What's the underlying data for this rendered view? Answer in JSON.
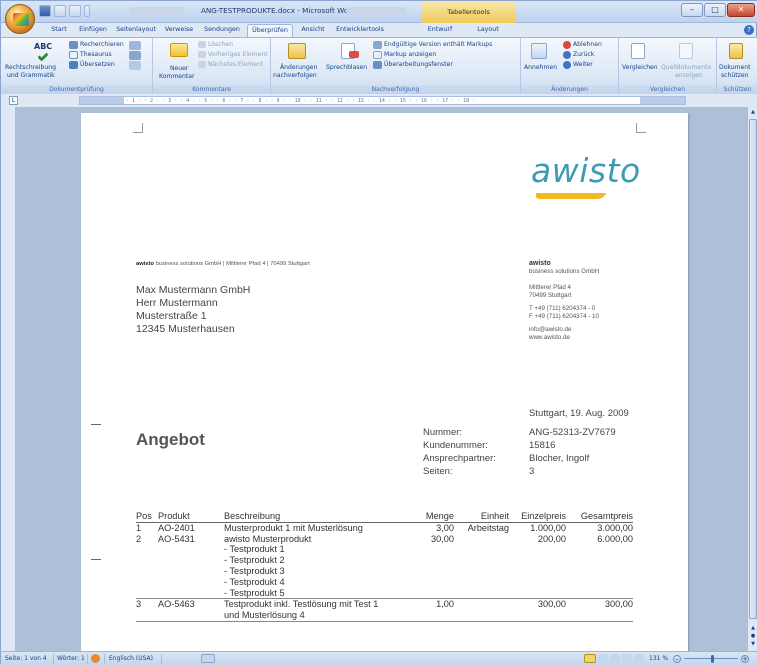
{
  "window": {
    "title": "ANG-TESTPRODUKTE.docx - Microsoft Word",
    "context_tab": "Tabellentools",
    "controls": [
      "–",
      "□",
      "✕"
    ]
  },
  "tabs": [
    "Start",
    "Einfügen",
    "Seitenlayout",
    "Verweise",
    "Sendungen",
    "Überprüfen",
    "Ansicht",
    "Entwicklertools",
    "Entwurf",
    "Layout"
  ],
  "active_tab": "Überprüfen",
  "ribbon": {
    "dokumentpruefung": {
      "label": "Dokumentprüfung",
      "spelling_top": "Rechtschreibung",
      "spelling_bottom": "und Grammatik",
      "recherchieren": "Recherchieren",
      "thesaurus": "Thesaurus",
      "uebersetzen": "Übersetzen"
    },
    "kommentare": {
      "label": "Kommentare",
      "neuer_top": "Neuer",
      "neuer_bottom": "Kommentar",
      "loeschen": "Löschen",
      "vorheriges": "Vorheriges Element",
      "naechstes": "Nächstes Element"
    },
    "nachverfolgung": {
      "label": "Nachverfolgung",
      "aenderungen_top": "Änderungen",
      "aenderungen_bottom": "nachverfolgen",
      "sprechblasen": "Sprechblasen",
      "endgueltig": "Endgültige Version enthält Markups",
      "markup": "Markup anzeigen",
      "ueberarbeitung": "Überarbeitungsfenster"
    },
    "aenderungen": {
      "label": "Änderungen",
      "annehmen": "Annehmen",
      "ablehnen": "Ablehnen",
      "zurueck": "Zurück",
      "weiter": "Weiter"
    },
    "vergleichen": {
      "label": "Vergleichen",
      "vergleichen": "Vergleichen",
      "quelldokumente_top": "Quelldokumente",
      "quelldokumente_bottom": "anzeigen"
    },
    "schuetzen": {
      "label": "Schützen",
      "dokument_top": "Dokument",
      "dokument_bottom": "schützen"
    }
  },
  "letter": {
    "logo": "awisto",
    "sender_line_brand": "awisto",
    "sender_line": "business solutions GmbH | Mittlerer Pfad 4 | 70499 Stuttgart",
    "recipient": [
      "Max Mustermann GmbH",
      "Herr Mustermann",
      "Musterstraße 1",
      "12345 Musterhausen"
    ],
    "company": {
      "name": "awisto",
      "subtitle": "business solutions GmbH",
      "street": "Mittlerer Pfad 4",
      "city": "70499 Stuttgart",
      "phone": "T +49 (711) 6204374 - 0",
      "fax": "F +49 (711) 6204374 - 10",
      "email": "info@awisto.de",
      "web": "www.awisto.de"
    },
    "date": "Stuttgart, 19. Aug. 2009",
    "heading": "Angebot",
    "meta": [
      {
        "label": "Nummer:",
        "value": "ANG-52313-ZV7679"
      },
      {
        "label": "Kundenummer:",
        "value": "15816"
      },
      {
        "label": "Ansprechpartner:",
        "value": "Blocher, Ingolf"
      },
      {
        "label": "Seiten:",
        "value": "3"
      }
    ],
    "table": {
      "headers": [
        "Pos",
        "Produkt",
        "Beschreibung",
        "Menge",
        "Einheit",
        "Einzelpreis",
        "Gesamtpreis"
      ],
      "rows": [
        {
          "pos": "1",
          "produkt": "AO-2401",
          "beschreibung": [
            "Musterprodukt 1 mit Musterlösung"
          ],
          "menge": "3,00",
          "einheit": "Arbeitstag",
          "einzelpreis": "1.000,00",
          "gesamtpreis": "3.000,00"
        },
        {
          "pos": "2",
          "produkt": "AO-5431",
          "beschreibung": [
            "awisto Musterprodukt",
            "- Testprodukt 1",
            "- Testprodukt 2",
            "- Testprodukt 3",
            "- Testprodukt 4",
            "- Testprodukt 5"
          ],
          "menge": "30,00",
          "einheit": "",
          "einzelpreis": "200,00",
          "gesamtpreis": "6.000,00"
        },
        {
          "pos": "3",
          "produkt": "AO-5463",
          "beschreibung": [
            "Testprodukt inkl. Testlösung mit Test 1",
            "und Musterlösung 4"
          ],
          "menge": "1,00",
          "einheit": "",
          "einzelpreis": "300,00",
          "gesamtpreis": "300,00"
        }
      ]
    }
  },
  "statusbar": {
    "page": "Seite: 1 von 4",
    "words": "Wörter: 1",
    "language": "Englisch (USA)",
    "zoom": "131 %"
  }
}
